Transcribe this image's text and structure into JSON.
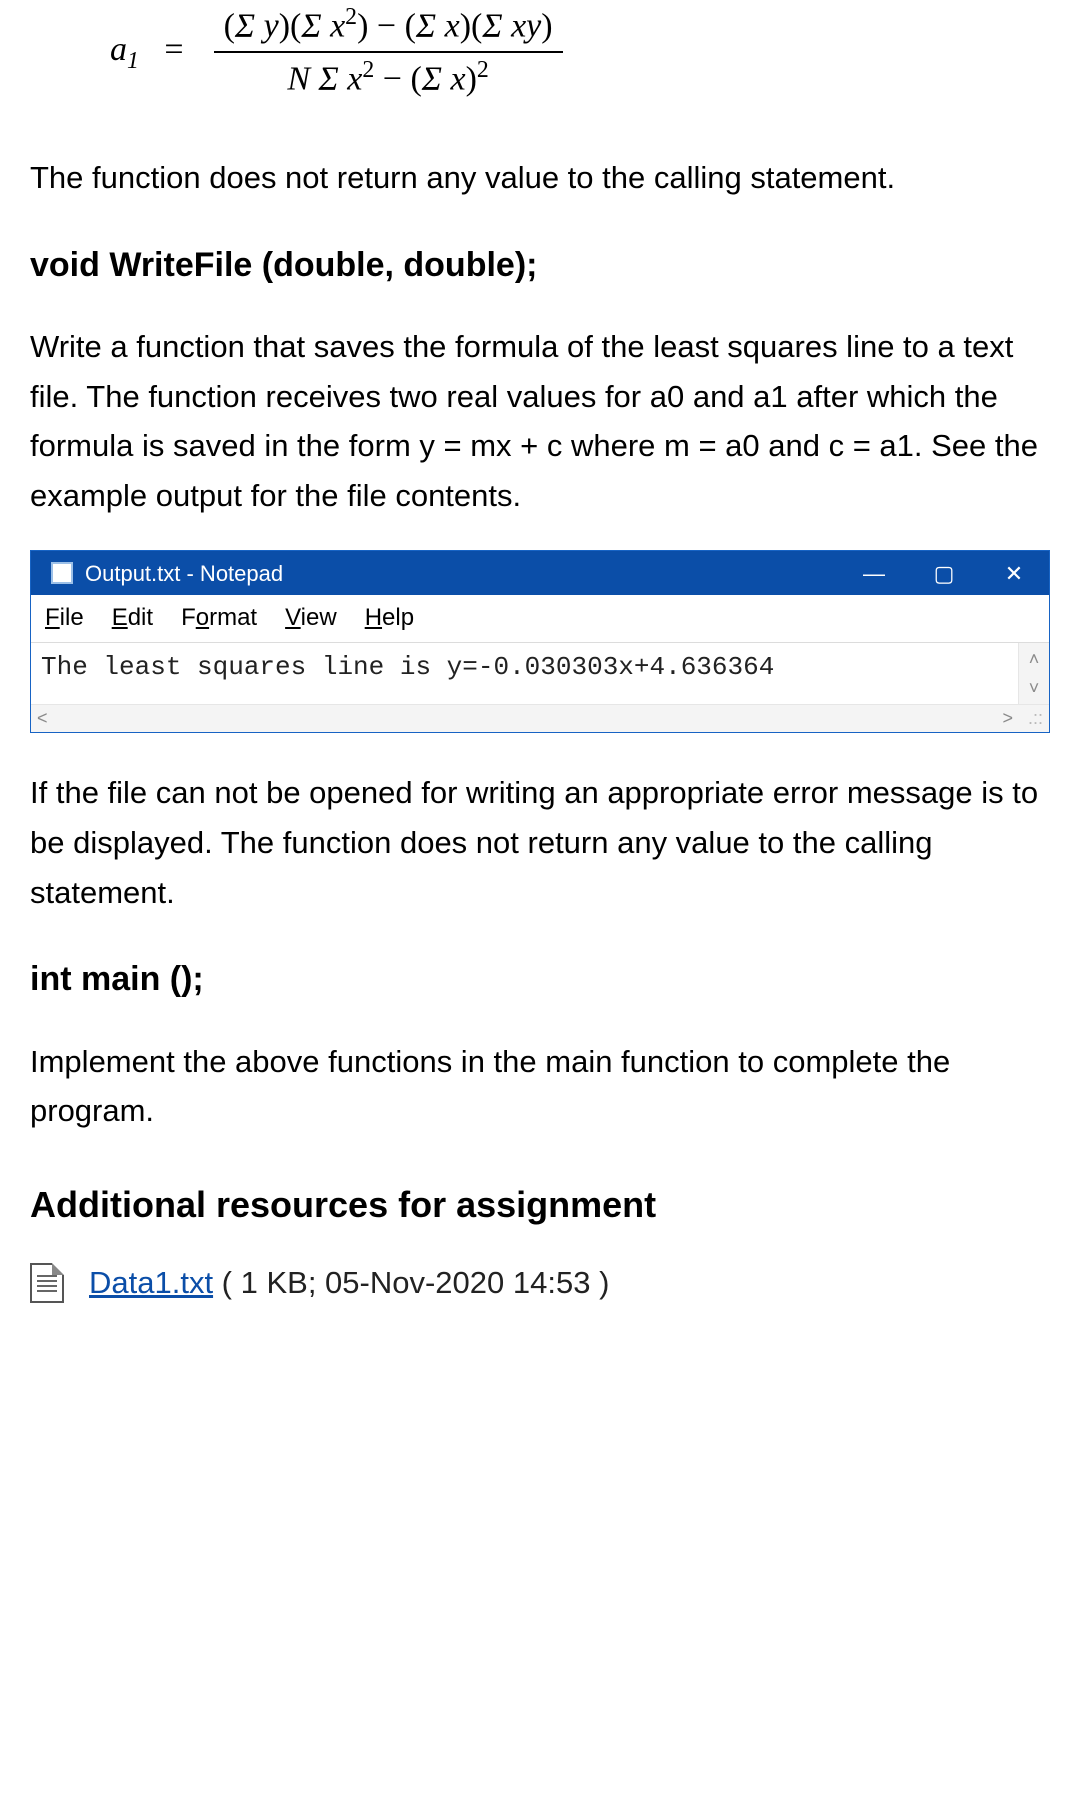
{
  "equation": {
    "lhs": "a",
    "lhs_sub": "1",
    "equals": "=",
    "numerator": "(Σ y)(Σ x²) − (Σ x)(Σ xy)",
    "denominator": "N Σ x² − (Σ x)²"
  },
  "para1": "The function does not return any value to the calling statement.",
  "sig1": "void WriteFile (double, double);",
  "para2": "Write a function that saves the formula of the least squares line to a text file. The function receives two real values for a0 and a1 after which  the formula is saved in the form y = mx + c where m = a0 and c = a1. See the example output for the file contents.",
  "notepad": {
    "title": "Output.txt - Notepad",
    "menu": {
      "file": "File",
      "edit": "Edit",
      "format": "Format",
      "view": "View",
      "help": "Help"
    },
    "content": "The least squares line is y=-0.030303x+4.636364",
    "minimize": "—",
    "maximize": "▢",
    "close": "✕",
    "scroll_up": "˄",
    "scroll_down": "˅",
    "scroll_left": "<",
    "scroll_right": ">",
    "grip": ".::"
  },
  "para3": "If the file can not be opened for writing an appropriate error message is to be displayed. The function does not return any value to the calling statement.",
  "sig2": "int main ();",
  "para4": "Implement the above functions in the main function to complete the program.",
  "heading_resources": "Additional resources for assignment",
  "attachment": {
    "name": "Data1.txt",
    "meta": " ( 1 KB; 05-Nov-2020 14:53 )"
  }
}
